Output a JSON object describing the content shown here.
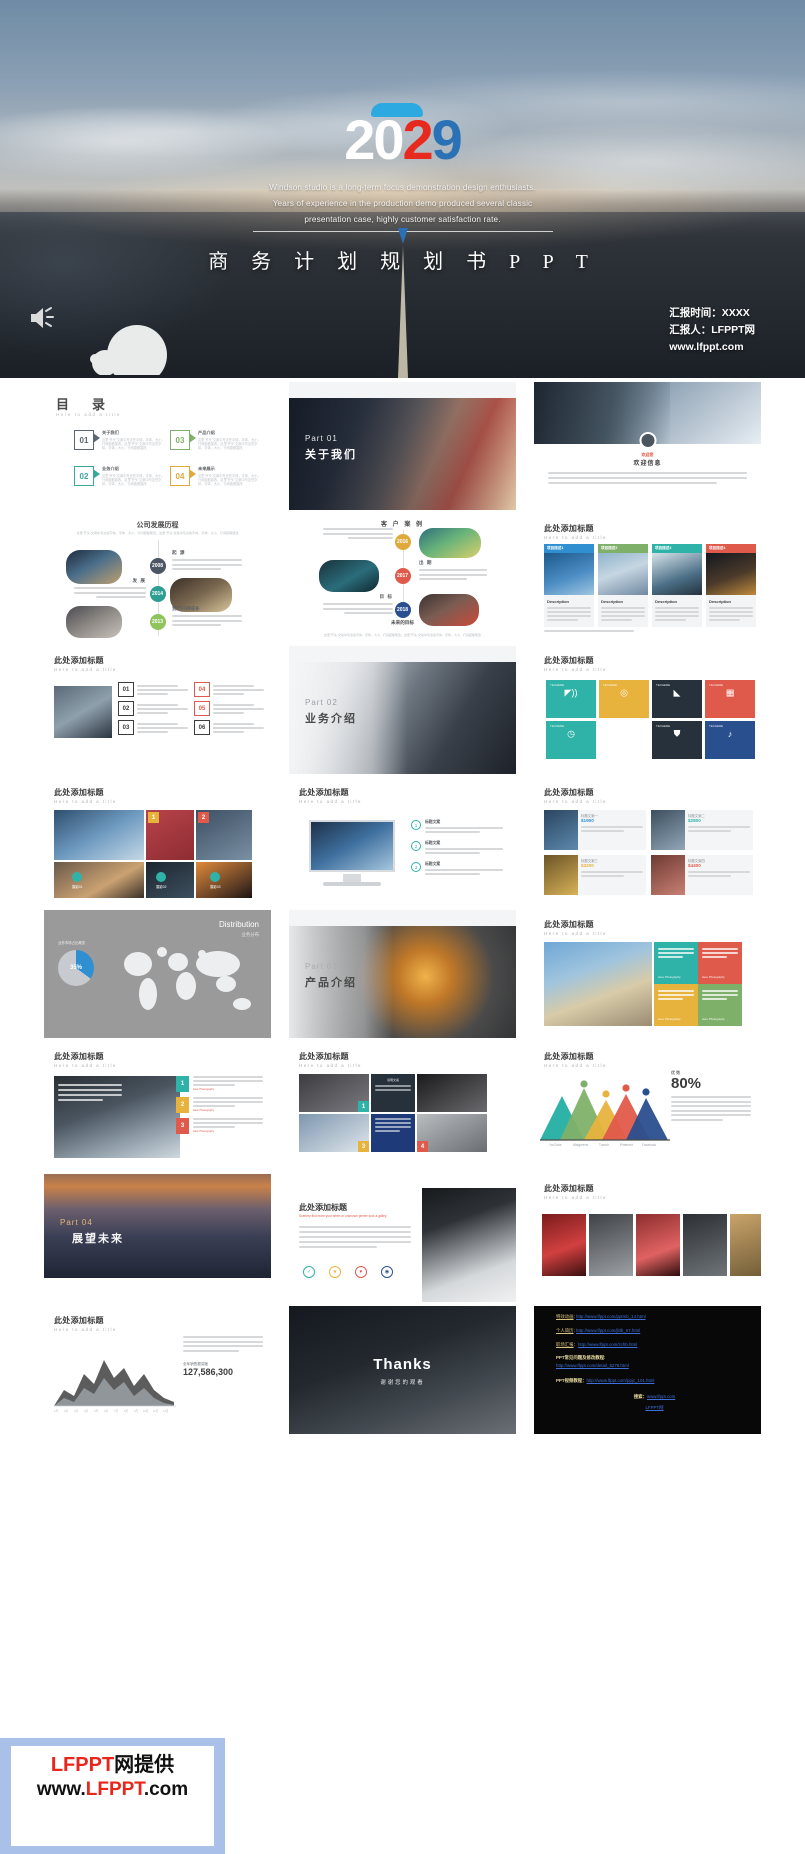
{
  "hero": {
    "year_parts": [
      "2",
      "0",
      "2",
      "9"
    ],
    "year": "2029",
    "subtitle_lines": [
      "Windson studio is a long-term focus demonstration design enthusiasts.",
      "Years of experience in the production demo produced several classic",
      "presentation case, highly customer satisfaction rate."
    ],
    "title": "商 务 计 划 规 划 书 P P T",
    "meta": [
      "汇报时间：XXXX",
      "汇报人：LFPPT网",
      "www.lfppt.com"
    ],
    "speaker_icon": "speaker-icon"
  },
  "slides": {
    "toc": {
      "heading": "目　录",
      "subheading": "Here to add a title",
      "items": [
        {
          "num": "01",
          "title": "关于我们",
          "body": "这里“开头”文案中写这些字体，字体、大小、行间距都能改。这里“开头”文案中写这些字体，字体、大小、行间距都能改",
          "color": "#5b6671"
        },
        {
          "num": "03",
          "title": "产品介绍",
          "body": "这里“开头”文案中写这些字体，字体、大小、行间距都能改。这里“开头”文案中写这些字体，字体、大小、行间距都能改",
          "color": "#7fb069"
        },
        {
          "num": "02",
          "title": "业务介绍",
          "body": "这里“开头”文案中写这些字体，字体、大小、行间距都能改。这里“开头”文案中写这些字体，字体、大小、行间距都能改",
          "color": "#3aa79a"
        },
        {
          "num": "04",
          "title": "未来展示",
          "body": "这里“开头”文案中写这些字体，字体、大小、行间距都能改。这里“开头”文案中写这些字体，字体、大小、行间距都能改",
          "color": "#e0a93c"
        }
      ]
    },
    "part01": {
      "label": "Part 01",
      "cn": "关于我们"
    },
    "part02": {
      "label": "Part 02",
      "cn": "业务介绍"
    },
    "part03": {
      "label": "Part 03",
      "cn": "产品介绍"
    },
    "part04": {
      "label": "Part 04",
      "cn": "展望未来"
    },
    "welcome": {
      "badge": "欢迎您",
      "title": "欢迎信息"
    },
    "timeline_left": {
      "title": "公司发展历程",
      "sub": "这里“开头”文案中写这些字体，字体、大小、行间距都能改。这里“开头”文案中写这些字体，字体、大小、行间距都能改",
      "rows": [
        {
          "year": "2008",
          "name": "起 源",
          "color": "#4b5563"
        },
        {
          "year": "2014",
          "name": "发 展",
          "color": "#2e9e92"
        },
        {
          "year": "2013",
          "name": "我们只讲成长",
          "color": "#8fc45c"
        }
      ]
    },
    "timeline_right": {
      "title": "客 户 案 例",
      "footer_title": "未来的目标",
      "footer_body": "这里“开头”文案中写这些字体，字体、大小、行间距都能改。这里“开头”文案中写这些字体，字体、大小、行间距都能改",
      "rows": [
        {
          "year": "2016",
          "name": "起 源",
          "color": "#e0a93c"
        },
        {
          "year": "2017",
          "name": "出 期",
          "color": "#e05a4b"
        },
        {
          "year": "2018",
          "name": "目 标",
          "color": "#2a4f8f"
        }
      ]
    },
    "project_cards": {
      "title": "此处添加标题",
      "sub": "Here to add a title",
      "cards": [
        {
          "tab": "项目描述1",
          "color": "#2f8fd0",
          "desc_title": "Description",
          "desc": "这里“开头”文案中写这些字体，字体、大小、行间距都能改，这里“开头”文案中写这些字体，字体、大小、行间距都能改"
        },
        {
          "tab": "项目描述2",
          "color": "#7fb069",
          "desc_title": "Description",
          "desc": "这里“开头”文案中写这些字体，字体、大小、行间距都能改，这里“开头”文案中写这些字体，字体、大小、行间距都能改"
        },
        {
          "tab": "项目描述3",
          "color": "#2fb3a8",
          "desc_title": "Description",
          "desc": "这里“开头”文案中写这些字体，字体、大小、行间距都能改，这里“开头”文案中写这些字体，字体、大小、行间距都能改"
        },
        {
          "tab": "项目描述4",
          "color": "#e05a4b",
          "desc_title": "Description",
          "desc": "这里“开头”文案中写这些字体，字体、大小、行间距都能改，这里“开头”文案中写这些字体，字体、大小、行间距都能改"
        }
      ]
    },
    "numbered_list": {
      "title": "此处添加标题",
      "sub": "Here to add a title",
      "items": [
        {
          "num": "01",
          "color": "#3c3c3c"
        },
        {
          "num": "04",
          "color": "#e05a4b"
        },
        {
          "num": "02",
          "color": "#e05a4b"
        },
        {
          "num": "05",
          "color": "#e05a4b"
        },
        {
          "num": "03",
          "color": "#3c3c3c"
        },
        {
          "num": "06",
          "color": "#3c3c3c"
        }
      ]
    },
    "icon_tiles": {
      "title": "此处添加标题",
      "sub": "Here to add a title",
      "tiles": [
        {
          "label": "TEXHERE",
          "icon": "megaphone-icon",
          "color": "#2fb3a8"
        },
        {
          "label": "TEXHERE",
          "icon": "target-icon",
          "color": "#e8b33d"
        },
        {
          "label": "TEXHERE",
          "icon": "tag-icon",
          "color": "#27313c"
        },
        {
          "label": "TEXHERE",
          "icon": "grid-icon",
          "color": "#e05a4b"
        },
        {
          "label": "TEXHERE",
          "icon": "clock-icon",
          "color": "#2fb3a8"
        },
        {
          "label": "TEXHERE",
          "icon": "shield-icon",
          "color": "#27313c"
        },
        {
          "label": "TEXHERE",
          "icon": "mic-icon",
          "color": "#2a4f8f"
        }
      ]
    },
    "gallery_tiles": {
      "title": "此处添加标题",
      "sub": "Here to add a title",
      "captions": [
        "摄影01",
        "摄影02",
        "摄影03"
      ],
      "corner_numbers": [
        "1",
        "2",
        "3"
      ]
    },
    "monitor": {
      "title": "此处添加标题",
      "sub": "Here to add a title",
      "items": [
        {
          "num": "1",
          "title": "标题文案",
          "body": "这里“开头”文案中写这些字体，字体、大小"
        },
        {
          "num": "2",
          "title": "标题文案",
          "body": "这里“开头”文案中写这些字体，字体、大小"
        },
        {
          "num": "3",
          "title": "标题文案",
          "body": "这里“开头”文案中写这些字体，字体、大小"
        }
      ]
    },
    "price_cards": {
      "title": "此处添加标题",
      "sub": "Here to add a title",
      "cards": [
        {
          "name": "标题文案一",
          "price": "$1900",
          "desc_title": "Description",
          "color": "#2f8fd0"
        },
        {
          "name": "标题文案二",
          "price": "$2800",
          "desc_title": "Description",
          "color": "#2fb3a8"
        },
        {
          "name": "标题文案三",
          "price": "$3200",
          "desc_title": "Description",
          "color": "#e8b33d"
        },
        {
          "name": "标题文案四",
          "price": "$4400",
          "desc_title": "Description",
          "color": "#e05a4b"
        }
      ]
    },
    "distribution": {
      "title": "Distribution",
      "sub": "业务分布",
      "percent": "35%",
      "legend": "业务市场占比概览"
    },
    "color_blocks": {
      "title": "此处添加标题",
      "sub": "Here to add a title",
      "blocks": [
        {
          "label": "Here Photography",
          "color": "#e05a4b"
        },
        {
          "label": "Here Photography",
          "color": "#e8b33d"
        },
        {
          "label": "Here Photography",
          "color": "#2fb3a8"
        },
        {
          "label": "Here Photography",
          "color": "#7fb069"
        }
      ]
    },
    "photo_num_list": {
      "title": "此处添加标题",
      "sub": "Here to add a title",
      "items": [
        {
          "num": "1",
          "color": "#2fb3a8",
          "body": "这里“开头”文案中写这些字体，字体、大小、行间距都能改。",
          "caption": "Here Photography"
        },
        {
          "num": "2",
          "color": "#e8b33d",
          "body": "这里“开头”文案中写这些字体，字体、大小、行间距都能改。",
          "caption": "Here Photography"
        },
        {
          "num": "3",
          "color": "#e05a4b",
          "body": "这里“开头”文案中写这些字体，字体、大小、行间距都能改。",
          "caption": "Here Photography"
        }
      ]
    },
    "photo_grid_4": {
      "title": "此处添加标题",
      "sub": "Here to add a title",
      "numbers": [
        "1",
        "2",
        "3",
        "4"
      ],
      "colors": [
        "#2fb3a8",
        "#27313c",
        "#e8b33d",
        "#e05a4b"
      ],
      "note": "这里是这些文案中写这些字体，这里是这些文案中写这些字体，这里是这些文案中写这些字体"
    },
    "mountain_chart": {
      "title": "此处添加标题",
      "sub": "Here to add a title",
      "headline_label": "优 势",
      "headline": "80%",
      "body": "这里写您的相关说明文案，这里是您的说明文案。文章内人需求提供了解我们的说明的以及了解的设计什么。想要提供的核心要点。这里可以详细说明您的想法。通过文章您的重要用途。让您的人提供理想的解了解我们的核心理念计算需求的这些点，可能我们需要的这些点。"
    },
    "thanks": {
      "title": "Thanks",
      "sub": "谢谢您的观看"
    },
    "keyboard_slide": {
      "title": "此处添加标题",
      "sub": "Scenery find more your when or unknown printer took a galley.",
      "body": "这里“开头”文案中写这些字体，字体、大小、行间距都能改。这里“开头”文案中写这些字体，字体、大小、行间距都能改。这里“开头”文案中写这些字体，字体、大小、行间距都能改。"
    },
    "photo_strip": {
      "title": "此处添加标题",
      "sub": "Here to add a title"
    },
    "area_chart": {
      "title": "此处添加标题",
      "sub": "Here to add a title",
      "metric_label": "全年销售额突破",
      "metric_value": "127,586,300"
    },
    "links": {
      "rows": [
        {
          "label": "特效动画",
          "sep": ": ",
          "url": "http://www.lfppt.com/pptmb_14.html"
        },
        {
          "label": "个人简历",
          "sep": ": ",
          "url": "http://www.lfppt.com/jldb_67.html"
        },
        {
          "label": "职场汇报",
          "sep": "：",
          "url": "http://www.lfppt.com/zchb.html"
        }
      ],
      "block1_label": "PPT常见问题及修改教程:",
      "block1_url": "http://www.lfppt.com/detail_5278.html",
      "block2_label": "PPT视频教程：",
      "block2_url": "http://www.lfppt.com/ppjc_101.html",
      "search_label": "搜索：",
      "search_url": "www.lfppt.com",
      "search_name": "LFPPT网"
    }
  },
  "footer": {
    "line1_red": "LFPPT",
    "line1_black": "网提供",
    "line2_pre": "www.",
    "line2_red": "LFPPT",
    "line2_post": ".com"
  },
  "chart_data": [
    {
      "type": "area",
      "title": "此处添加标题",
      "categories": [
        "1月",
        "2月",
        "3月",
        "4月",
        "5月",
        "6月",
        "7月",
        "8月",
        "9月",
        "10月",
        "11月",
        "12月"
      ],
      "series": [
        {
          "name": "系列1",
          "values": [
            20,
            34,
            28,
            55,
            42,
            70,
            52,
            63,
            45,
            58,
            38,
            30
          ]
        },
        {
          "name": "系列2",
          "values": [
            12,
            22,
            18,
            36,
            28,
            48,
            33,
            44,
            30,
            40,
            25,
            18
          ]
        }
      ],
      "ylabel": "",
      "xlabel": "",
      "ylim": [
        0,
        80
      ],
      "grid": false,
      "annotation_label": "全年销售额突破",
      "annotation_value": "127,586,300"
    },
    {
      "type": "area",
      "title": "优 势",
      "categories": [
        "YouTube",
        "Walgreens",
        "Tumblr",
        "Pinterest",
        "Facebook"
      ],
      "values": [
        62,
        78,
        55,
        70,
        58
      ],
      "series": [
        {
          "name": "YouTube",
          "values": [
            62
          ],
          "color": "#2fb3a8"
        },
        {
          "name": "Walgreens",
          "values": [
            78
          ],
          "color": "#7fb069"
        },
        {
          "name": "Tumblr",
          "values": [
            55
          ],
          "color": "#e8b33d"
        },
        {
          "name": "Pinterest",
          "values": [
            70
          ],
          "color": "#e05a4b"
        },
        {
          "name": "Facebook",
          "values": [
            58
          ],
          "color": "#2a4f8f"
        }
      ],
      "headline": "80%",
      "ylim": [
        0,
        100
      ],
      "grid": false,
      "legend": "bottom"
    },
    {
      "type": "pie",
      "title": "Distribution",
      "subtitle": "业务分布",
      "categories": [
        "占比",
        "其他"
      ],
      "values": [
        35,
        65
      ],
      "labels": [
        "35%",
        ""
      ],
      "legend": "none"
    }
  ]
}
